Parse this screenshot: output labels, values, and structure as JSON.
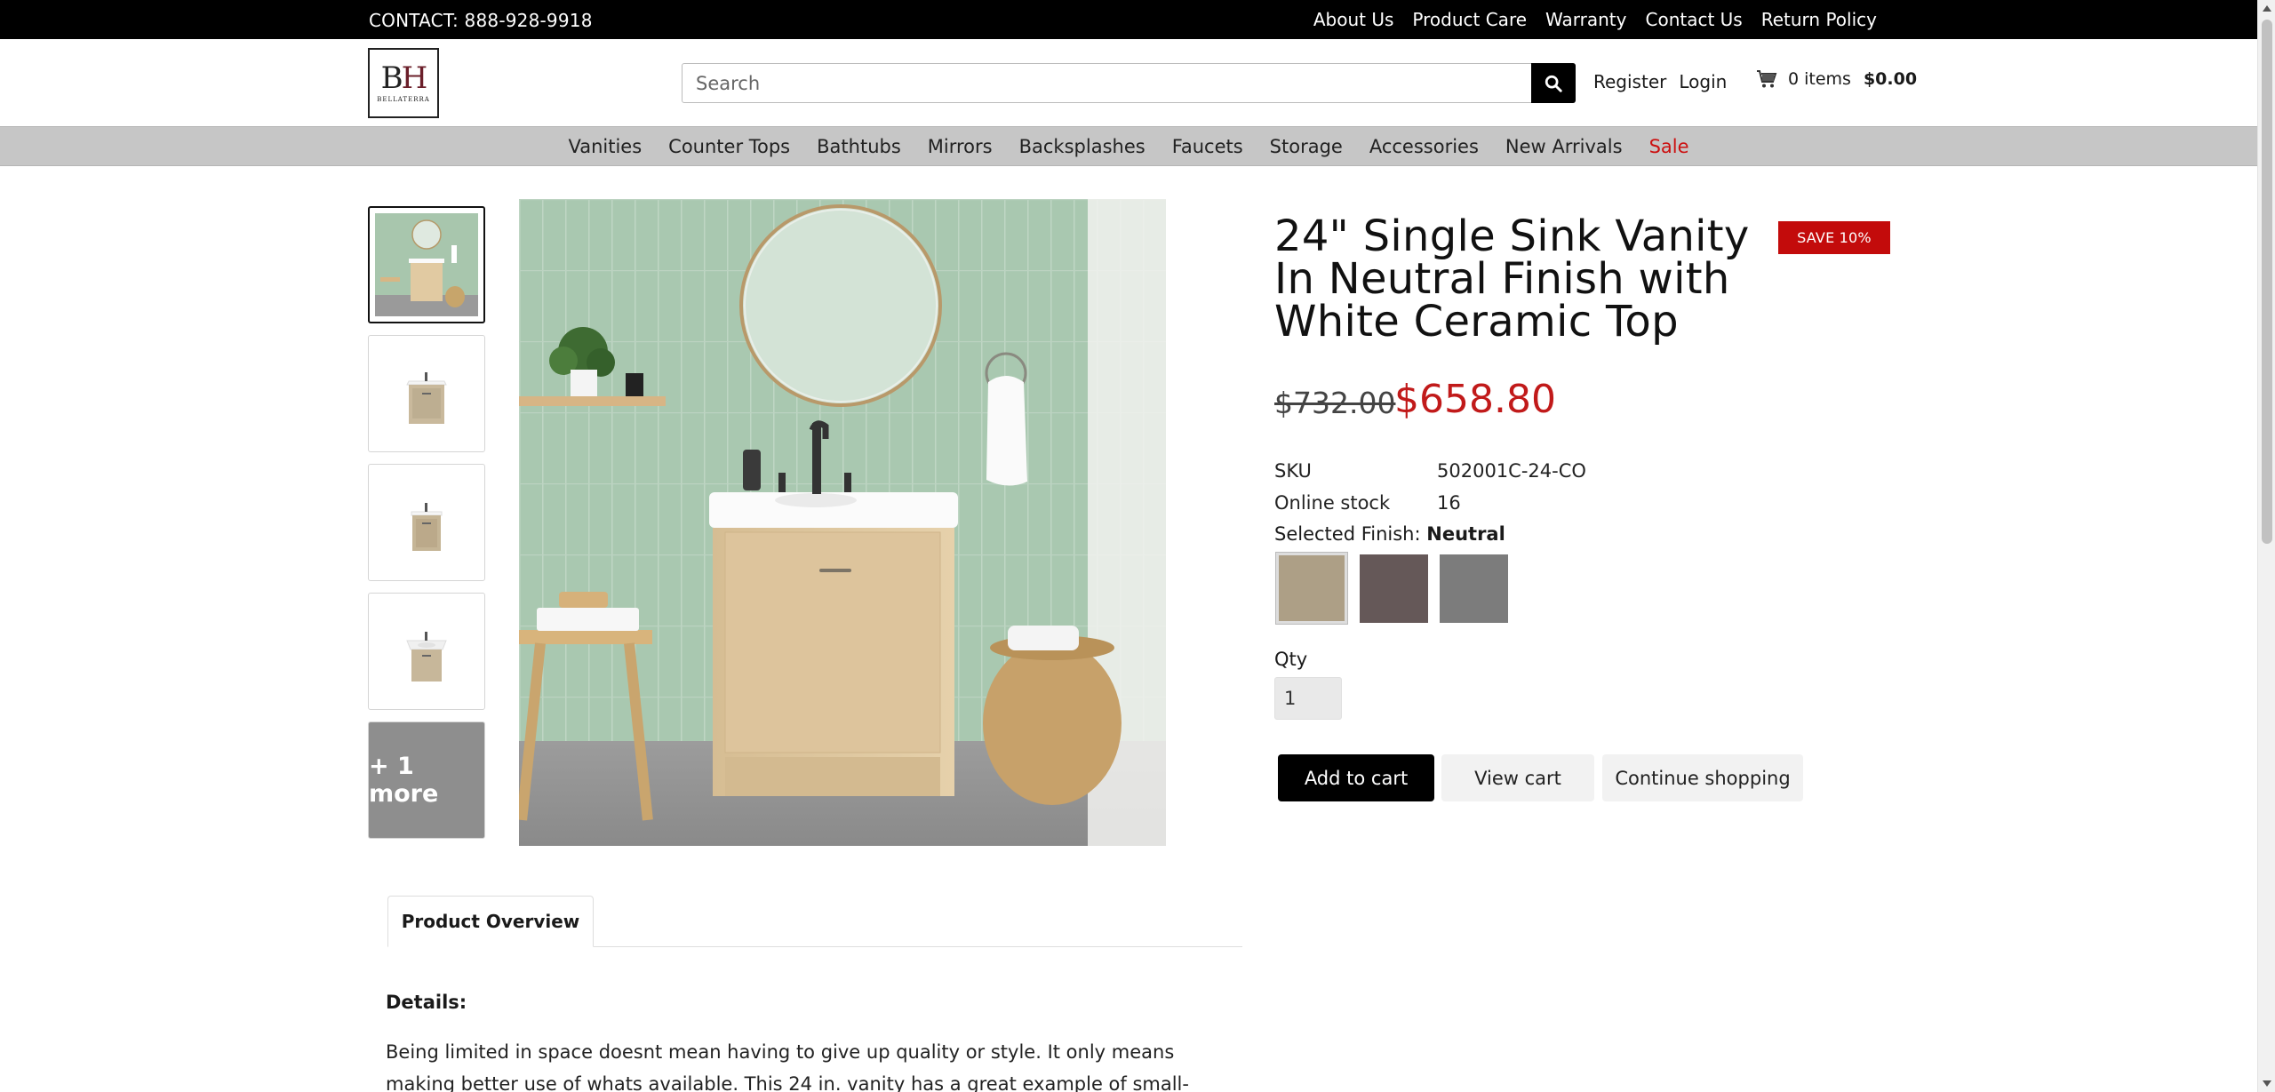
{
  "topbar": {
    "contact": "CONTACT: 888-928-9918",
    "links": [
      "About Us",
      "Product Care",
      "Warranty",
      "Contact Us",
      "Return Policy"
    ]
  },
  "header": {
    "logo_mono_b": "B",
    "logo_mono_h": "H",
    "logo_brand": "BELLATERRA",
    "search_placeholder": "Search",
    "register": "Register",
    "login": "Login",
    "cart_items": "0 items",
    "cart_total": "$0.00"
  },
  "nav": {
    "items": [
      "Vanities",
      "Counter Tops",
      "Bathtubs",
      "Mirrors",
      "Backsplashes",
      "Faucets",
      "Storage",
      "Accessories",
      "New Arrivals",
      "Sale"
    ]
  },
  "gallery": {
    "more_label": "+ 1 more"
  },
  "product": {
    "title": "24\" Single Sink Vanity In Neutral Finish with White Ceramic Top",
    "badge": "SAVE 10%",
    "price_old": "$732.00",
    "price_new": "$658.80",
    "sku_label": "SKU",
    "sku_value": "502001C-24-CO",
    "stock_label": "Online stock",
    "stock_value": "16",
    "finish_label": "Selected Finish:",
    "finish_value": "Neutral",
    "swatches": [
      {
        "color": "#ad9f86"
      },
      {
        "color": "#655858"
      },
      {
        "color": "#7c7c7c"
      }
    ],
    "qty_label": "Qty",
    "qty_value": "1",
    "add_to_cart": "Add to cart",
    "view_cart": "View cart",
    "continue_shopping": "Continue shopping"
  },
  "tabs": {
    "overview": "Product Overview"
  },
  "details": {
    "heading": "Details:",
    "text": "Being limited in space doesnt mean having to give up quality or style. It only means making better use of whats available. This 24 in. vanity has a great example of small-space thinking."
  },
  "colors": {
    "accent_red": "#c11a1a",
    "badge_red": "#c30b0b",
    "nav_gray": "#c6c6c6"
  }
}
